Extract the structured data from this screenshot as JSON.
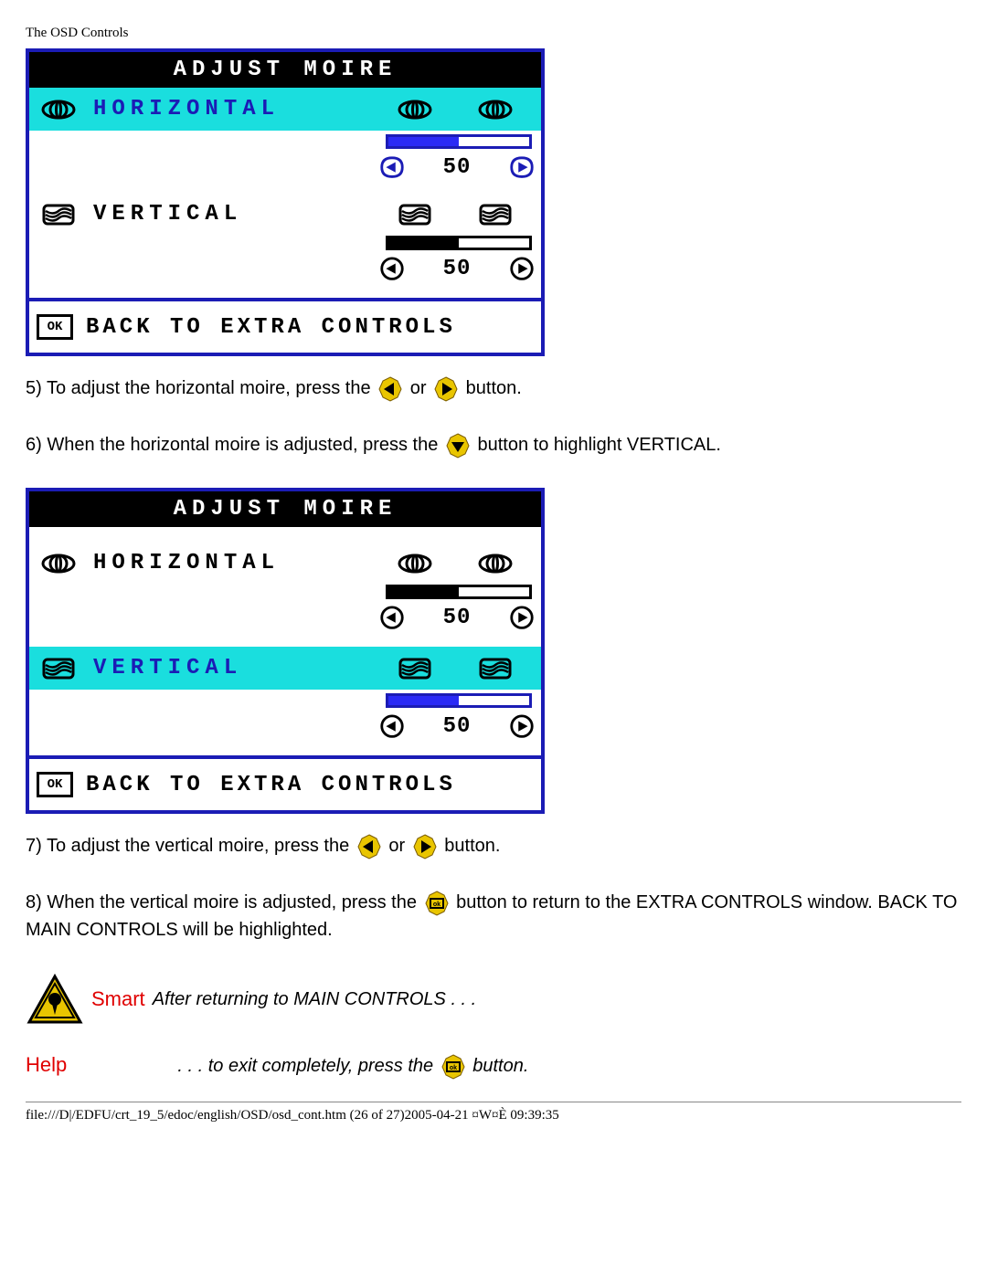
{
  "header": {
    "title": "The OSD Controls"
  },
  "osd_title": "ADJUST MOIRE",
  "rows": {
    "horizontal": {
      "label": "HORIZONTAL",
      "value": 50
    },
    "vertical": {
      "label": "VERTICAL",
      "value": 50
    }
  },
  "back_row": {
    "ok_label": "OK",
    "label": "BACK TO EXTRA CONTROLS"
  },
  "steps": {
    "s5a": "5) To adjust the horizontal moire, press the ",
    "s5b": " or ",
    "s5c": " button.",
    "s6a": "6) When the horizontal moire is adjusted, press the ",
    "s6b": " button to highlight VERTICAL.",
    "s7a": "7) To adjust the vertical moire, press the ",
    "s7b": " or ",
    "s7c": " button.",
    "s8a": "8) When the vertical moire is adjusted, press the ",
    "s8b": " button to return to the EXTRA CONTROLS window. BACK TO MAIN CONTROLS will be highlighted."
  },
  "smart": {
    "label": "Smart",
    "help_label": "Help",
    "line1": " After returning to MAIN CONTROLS . . .",
    "line2a": ". . . to exit completely, press the ",
    "line2b": " button."
  },
  "footer": "file:///D|/EDFU/crt_19_5/edoc/english/OSD/osd_cont.htm (26 of 27)2005-04-21 ¤W¤È 09:39:35"
}
